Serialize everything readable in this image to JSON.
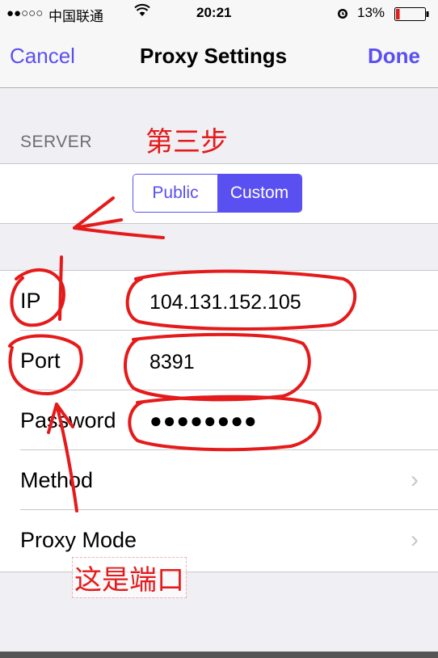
{
  "status_bar": {
    "signal": "●●○○○",
    "carrier": "中国联通",
    "wifi_icon": "wifi-icon",
    "time": "20:21",
    "alarm_icon": "alarm-icon",
    "battery_percent": "13%",
    "battery_level": 0.13
  },
  "nav": {
    "cancel": "Cancel",
    "title": "Proxy Settings",
    "done": "Done"
  },
  "section": {
    "server_label": "SERVER"
  },
  "segmented": {
    "options": [
      "Public",
      "Custom"
    ],
    "selected": "Custom"
  },
  "form": {
    "ip_label": "IP",
    "ip_value": "104.131.152.105",
    "port_label": "Port",
    "port_value": "8391",
    "password_label": "Password",
    "password_value": "●●●●●●●●",
    "method_label": "Method",
    "proxy_mode_label": "Proxy Mode",
    "chevron": "›"
  },
  "annotations": {
    "step_label": "第三步",
    "port_note": "这是端口"
  },
  "colors": {
    "accent": "#5a4ff0",
    "annotation": "#e51a1a",
    "background": "#efeff4"
  }
}
